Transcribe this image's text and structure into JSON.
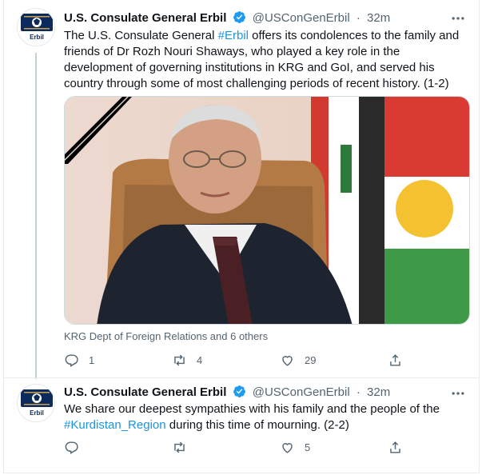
{
  "tweets": [
    {
      "avatar_text": "Erbil",
      "name": "U.S. Consulate General Erbil",
      "handle": "@USConGenErbil",
      "separator": "·",
      "time": "32m",
      "text_parts": [
        "The U.S. Consulate General ",
        "#Erbil",
        " offers its condolences to the family and friends of Dr Rozh Nouri Shaways, who played a key role in the development of governing institutions in KRG and GoI, and served his country through some of most challenging periods of recent history. (1-2)"
      ],
      "tagged": "KRG Dept of Foreign Relations and 6 others",
      "reply_count": "1",
      "retweet_count": "4",
      "like_count": "29"
    },
    {
      "avatar_text": "Erbil",
      "name": "U.S. Consulate General Erbil",
      "handle": "@USConGenErbil",
      "separator": "·",
      "time": "32m",
      "text_parts": [
        "We share our deepest sympathies with his family and the people of the ",
        "#Kurdistan_Region",
        " during this time of mourning. (2-2)"
      ],
      "reply_count": "",
      "retweet_count": "",
      "like_count": "5"
    }
  ],
  "colors": {
    "link": "#1b95e0",
    "verified": "#1d9bf0",
    "muted": "#536471"
  },
  "icons": [
    "verified-badge-icon",
    "more-icon",
    "reply-icon",
    "retweet-icon",
    "like-icon",
    "share-icon"
  ]
}
